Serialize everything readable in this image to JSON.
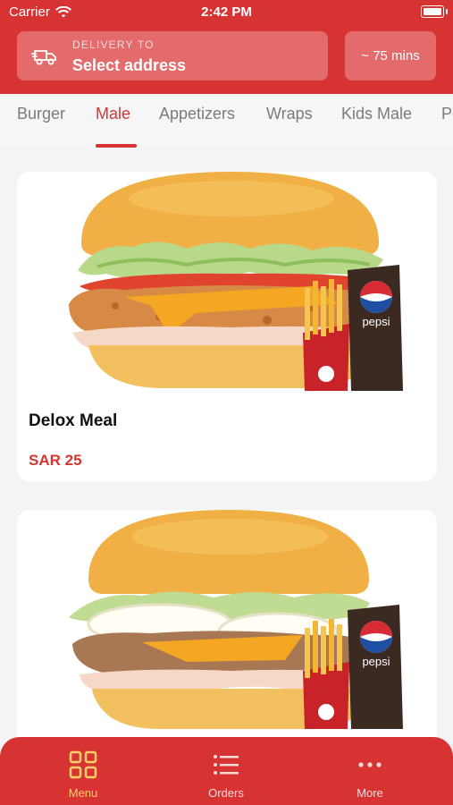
{
  "status": {
    "carrier": "Carrier",
    "time": "2:42 PM"
  },
  "header": {
    "delivery_label": "DELIVERY TO",
    "address": "Select address",
    "eta": "~ 75 mins"
  },
  "tabs": [
    {
      "label": "Burger"
    },
    {
      "label": "Male"
    },
    {
      "label": "Appetizers"
    },
    {
      "label": "Wraps"
    },
    {
      "label": "Kids Male"
    },
    {
      "label": "Po"
    }
  ],
  "menu_items": [
    {
      "name": "Delox Meal",
      "price": "SAR 25",
      "image_text": "pepsi"
    },
    {
      "name": "",
      "price": "",
      "image_text": "pepsi"
    }
  ],
  "bottom_nav": [
    {
      "label": "Menu",
      "icon": "grid-icon",
      "active": true
    },
    {
      "label": "Orders",
      "icon": "list-icon",
      "active": false
    },
    {
      "label": "More",
      "icon": "more-icon",
      "active": false
    }
  ],
  "colors": {
    "primary": "#d83333",
    "nav_active": "#ffcf6a"
  }
}
